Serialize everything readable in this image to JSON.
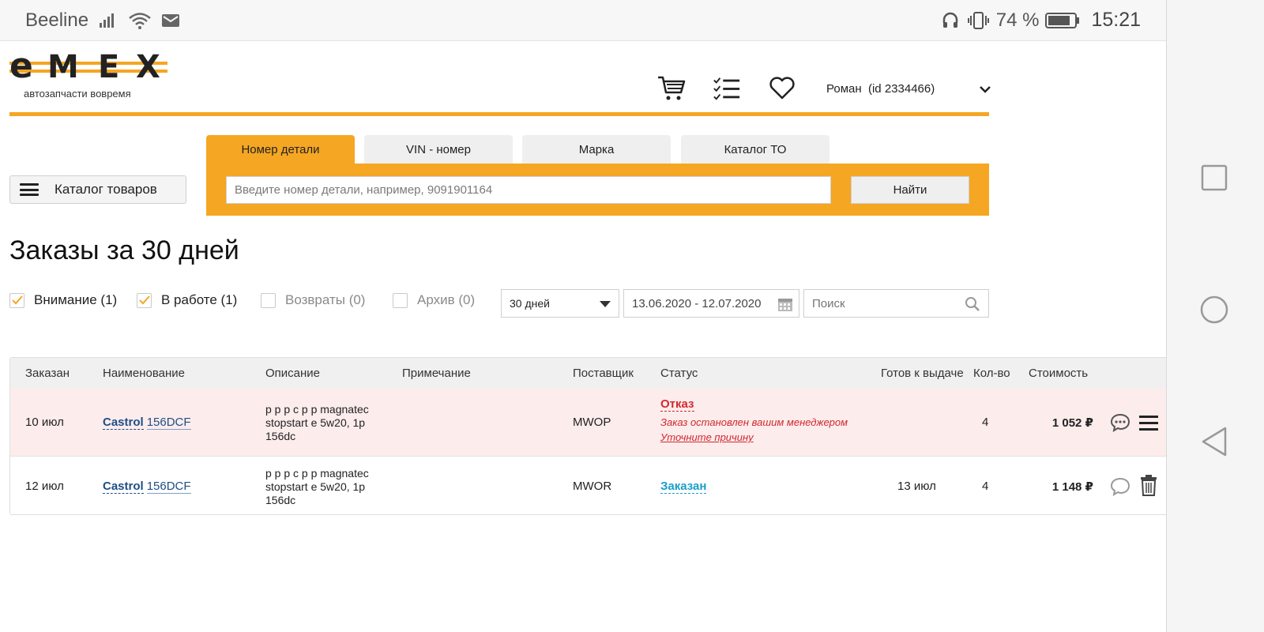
{
  "statusbar": {
    "carrier": "Beeline",
    "battery_percent": "74 %",
    "time": "15:21"
  },
  "header": {
    "logo_text": "e-M-E-X",
    "logo_tagline": "автозапчасти вовремя",
    "user_name": "Роман",
    "user_id": "(id 2334466)"
  },
  "catalog_button": {
    "label": "Каталог товаров"
  },
  "search": {
    "tabs": [
      "Номер детали",
      "VIN - номер",
      "Марка",
      "Каталог ТО"
    ],
    "active_tab": "Номер детали",
    "placeholder": "Введите номер детали, например, 9091901164",
    "button_label": "Найти"
  },
  "page_title": "Заказы за 30 дней",
  "filters": {
    "checkboxes": [
      {
        "label": "Внимание (1)",
        "checked": true
      },
      {
        "label": "В работе (1)",
        "checked": true
      },
      {
        "label": "Возвраты (0)",
        "checked": false
      },
      {
        "label": "Архив (0)",
        "checked": false
      }
    ],
    "period_select": "30 дней",
    "date_range": "13.06.2020 - 12.07.2020",
    "search_placeholder": "Поиск"
  },
  "table": {
    "columns": [
      "Заказан",
      "Наименование",
      "Описание",
      "Примечание",
      "Поставщик",
      "Статус",
      "Готов к выдаче",
      "Кол-во",
      "Стоимость"
    ],
    "rows": [
      {
        "ordered": "10 июл",
        "brand": "Castrol",
        "code": "156DCF",
        "description": "р р р с р р magnatec stopstart e 5w20, 1p 156dc",
        "note": "",
        "supplier": "MWOP",
        "status": "Отказ",
        "status_note": "Заказ остановлен вашим менеджером",
        "status_link": "Уточните причину",
        "ready": "",
        "qty": "4",
        "price": "1 052 ₽"
      },
      {
        "ordered": "12 июл",
        "brand": "Castrol",
        "code": "156DCF",
        "description": "р р р с р р magnatec stopstart e 5w20, 1p 156dc",
        "note": "",
        "supplier": "MWOR",
        "status": "Заказан",
        "status_note": "",
        "status_link": "",
        "ready": "13 июл",
        "qty": "4",
        "price": "1 148 ₽"
      }
    ]
  },
  "colors": {
    "accent": "#f5a623",
    "refused_row_bg": "#fcecec",
    "status_refused": "#d2282e",
    "status_ordered": "#1aa0c8",
    "link_blue": "#1f4e85"
  }
}
